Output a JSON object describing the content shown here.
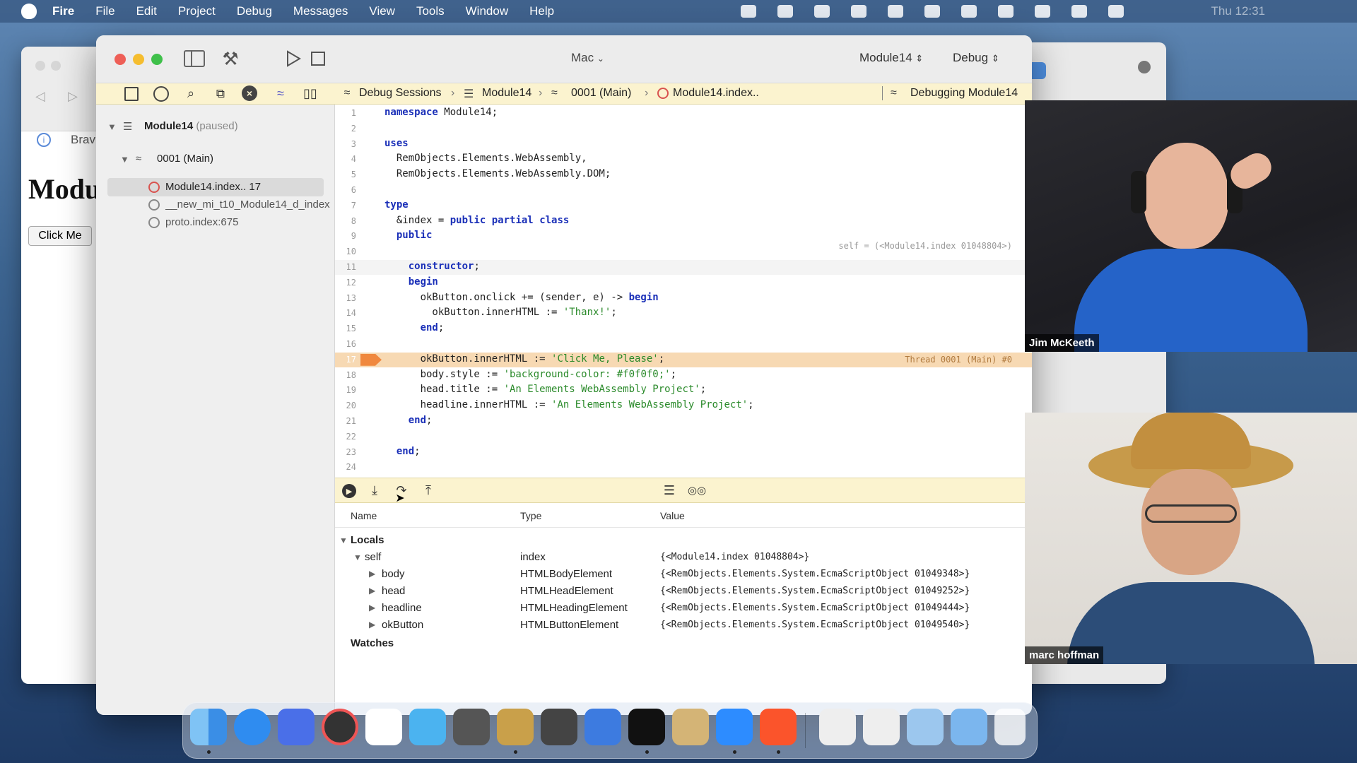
{
  "menubar": {
    "app_name": "Fire",
    "items": [
      "File",
      "Edit",
      "Project",
      "Debug",
      "Messages",
      "View",
      "Tools",
      "Window",
      "Help"
    ],
    "clock": "Thu 12:31"
  },
  "browser": {
    "tab_label": "Brav",
    "heading": "Modu",
    "button_label": "Click Me"
  },
  "titlebar": {
    "destination": "Mac",
    "project": "Module14",
    "configuration": "Debug"
  },
  "navbar": {
    "crumbs": [
      "Debug Sessions",
      "Module14",
      "0001 (Main)",
      "Module14.index.."
    ],
    "right_label": "Debugging Module14"
  },
  "sidebar": {
    "session_name": "Module14",
    "session_state": "(paused)",
    "thread": "0001 (Main)",
    "frames": [
      "Module14.index.. 17",
      "__new_mi_t10_Module14_d_index",
      "proto.index:675"
    ]
  },
  "editor": {
    "lines": [
      {
        "n": "1",
        "t": "namespace Module14;"
      },
      {
        "n": "2",
        "t": ""
      },
      {
        "n": "3",
        "t": "uses"
      },
      {
        "n": "4",
        "t": "  RemObjects.Elements.WebAssembly,"
      },
      {
        "n": "5",
        "t": "  RemObjects.Elements.WebAssembly.DOM;"
      },
      {
        "n": "6",
        "t": ""
      },
      {
        "n": "7",
        "t": "type"
      },
      {
        "n": "8",
        "t": "  &index = public partial class"
      },
      {
        "n": "9",
        "t": "  public"
      },
      {
        "n": "10",
        "t": ""
      },
      {
        "n": "11",
        "t": "    constructor;"
      },
      {
        "n": "12",
        "t": "    begin"
      },
      {
        "n": "13",
        "t": "      okButton.onclick += (sender, e) -> begin"
      },
      {
        "n": "14",
        "t": "        okButton.innerHTML := 'Thanx!';"
      },
      {
        "n": "15",
        "t": "      end;"
      },
      {
        "n": "16",
        "t": ""
      },
      {
        "n": "17",
        "t": "      okButton.innerHTML := 'Click Me, Please';"
      },
      {
        "n": "18",
        "t": "      body.style := 'background-color: #f0f0f0;';"
      },
      {
        "n": "19",
        "t": "      head.title := 'An Elements WebAssembly Project';"
      },
      {
        "n": "20",
        "t": "      headline.innerHTML := 'An Elements WebAssembly Project';"
      },
      {
        "n": "21",
        "t": "    end;"
      },
      {
        "n": "22",
        "t": ""
      },
      {
        "n": "23",
        "t": "  end;"
      },
      {
        "n": "24",
        "t": ""
      }
    ],
    "self_hint": "self = (<Module14.index 01048804>)",
    "thread_hint": "Thread 0001 (Main) #0"
  },
  "vars": {
    "headers": {
      "name": "Name",
      "type": "Type",
      "value": "Value"
    },
    "locals_label": "Locals",
    "rows": [
      {
        "name": "self",
        "type": "index",
        "value": "{<Module14.index 01048804>}"
      },
      {
        "name": "body",
        "type": "HTMLBodyElement",
        "value": "{<RemObjects.Elements.System.EcmaScriptObject 01049348>}"
      },
      {
        "name": "head",
        "type": "HTMLHeadElement",
        "value": "{<RemObjects.Elements.System.EcmaScriptObject 01049252>}"
      },
      {
        "name": "headline",
        "type": "HTMLHeadingElement",
        "value": "{<RemObjects.Elements.System.EcmaScriptObject 01049444>}"
      },
      {
        "name": "okButton",
        "type": "HTMLButtonElement",
        "value": "{<RemObjects.Elements.System.EcmaScriptObject 01049540>}"
      }
    ],
    "watches_label": "Watches"
  },
  "cams": [
    {
      "name": "Jim McKeeth"
    },
    {
      "name": "marc hoffman"
    }
  ],
  "colors": {
    "keyword": "#1a2fb8",
    "string": "#2a8a2a",
    "current_line": "#f7d9b3",
    "breakpoint": "#f0883e",
    "navbar_bg": "#fbf3cf"
  }
}
